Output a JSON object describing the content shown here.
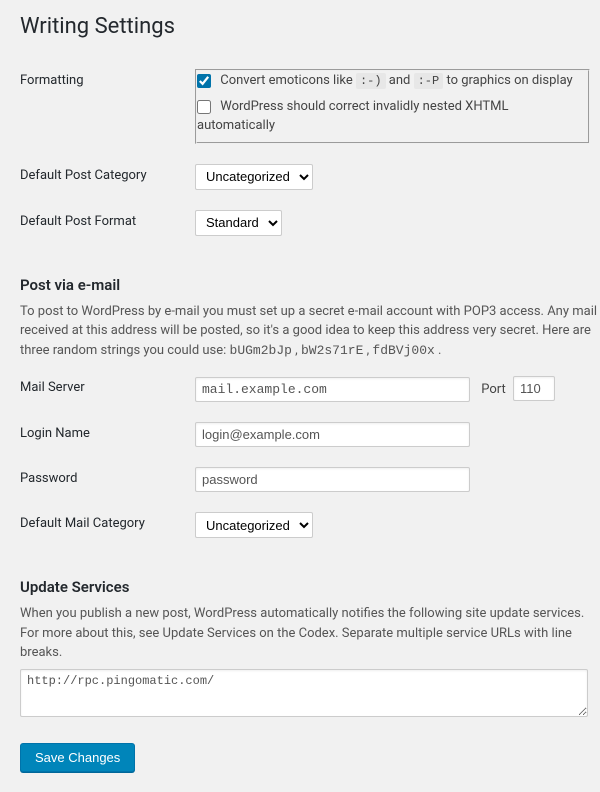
{
  "page_title": "Writing Settings",
  "formatting": {
    "label": "Formatting",
    "cb1_checked": true,
    "cb1_before": "Convert emoticons like ",
    "cb1_code1": ":-)",
    "cb1_mid": " and ",
    "cb1_code2": ":-P",
    "cb1_after": " to graphics on display",
    "cb2_checked": false,
    "cb2_text": "WordPress should correct invalidly nested XHTML automatically"
  },
  "default_post_category": {
    "label": "Default Post Category",
    "value": "Uncategorized"
  },
  "default_post_format": {
    "label": "Default Post Format",
    "value": "Standard"
  },
  "post_via_email": {
    "heading": "Post via e-mail",
    "desc_before": "To post to WordPress by e-mail you must set up a secret e-mail account with POP3 access. Any mail received at this address will be posted, so it's a good idea to keep this address very secret. Here are three random strings you could use: ",
    "rand1": "bUGm2bJp",
    "sep": " , ",
    "rand2": "bW2s71rE",
    "rand3": "fdBVj00x",
    "end": " ."
  },
  "mail_server": {
    "label": "Mail Server",
    "value": "mail.example.com",
    "port_label": "Port",
    "port_value": "110"
  },
  "login_name": {
    "label": "Login Name",
    "value": "login@example.com"
  },
  "password": {
    "label": "Password",
    "value": "password"
  },
  "default_mail_category": {
    "label": "Default Mail Category",
    "value": "Uncategorized"
  },
  "update_services": {
    "heading": "Update Services",
    "desc": "When you publish a new post, WordPress automatically notifies the following site update services. For more about this, see Update Services on the Codex. Separate multiple service URLs with line breaks.",
    "value": "http://rpc.pingomatic.com/"
  },
  "submit": {
    "label": "Save Changes"
  }
}
